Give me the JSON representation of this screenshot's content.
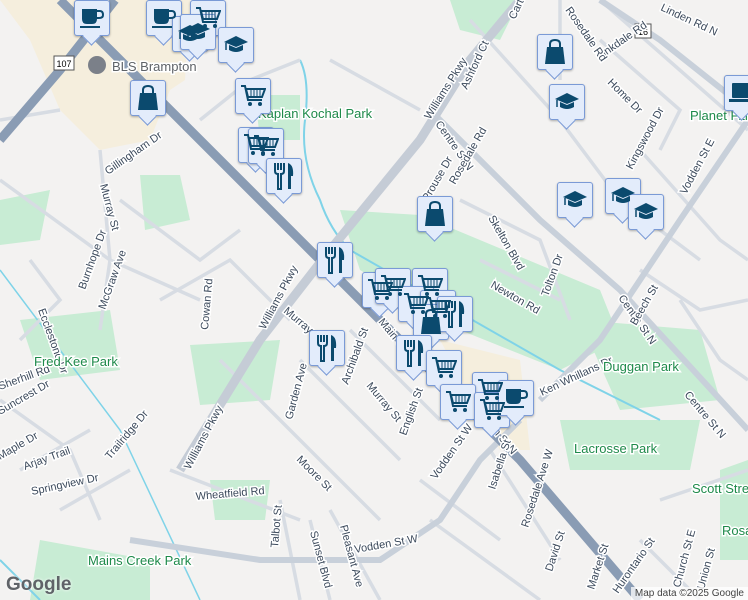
{
  "map": {
    "poi": "BLS Brampton",
    "route_shields": [
      "107",
      "16"
    ],
    "parks": [
      "Kaplan Kochal Park",
      "Fred Kee Park",
      "Duggan Park",
      "Lacrosse Park",
      "Planet Fitness",
      "Scott Street Parkette",
      "Rosalea Park",
      "Mains Creek Park"
    ],
    "streets": [
      "Williams Pkwy",
      "Williams Pkwy",
      "Williams Pkwy",
      "Gillingham Dr",
      "Murray St",
      "Murray St",
      "Murray St",
      "Burnhope Dr",
      "McGraw Ave",
      "Ecclestone Dr",
      "Cowan Rd",
      "Garden Ave",
      "Archibald St",
      "Main St N",
      "Main St N",
      "English St",
      "Centre St N",
      "Centre St N",
      "Centre St N",
      "Prouse Dr",
      "Rosedale Rd",
      "Skelton Blvd",
      "Newton Rd",
      "Tolton Dr",
      "Ashford Ct",
      "Carter Dr",
      "Linkdale Rd",
      "Home Dr",
      "Kingswood Dr",
      "Vodden St E",
      "Beech St",
      "Ken Whillans Dr",
      "Moore St",
      "Wheatfield Rd",
      "Talbot St",
      "Vodden St W",
      "Vodden St W",
      "Isabella St",
      "Rosedale Ave W",
      "David St",
      "Market St",
      "Church St E",
      "Union St",
      "Hurontario St",
      "Sunset Blvd",
      "Pleasant Ave",
      "Suncrest Dr",
      "Maple Dr",
      "Arjay Trail",
      "Trailridge Dr",
      "Springview Dr",
      "Sherhill Rd",
      "Linden Rd N",
      "Rosedale Rd"
    ],
    "markers": [
      "coffee",
      "coffee",
      "cart",
      "school",
      "school",
      "school",
      "bag",
      "cart",
      "cart",
      "cart",
      "restaurant",
      "restaurant",
      "bag",
      "school",
      "laptop",
      "bag",
      "school",
      "school",
      "school",
      "cart",
      "cart",
      "cart",
      "cart",
      "cart",
      "bag",
      "restaurant",
      "restaurant",
      "restaurant",
      "cart",
      "cart",
      "cart",
      "cart",
      "coffee"
    ]
  },
  "footer": {
    "logo": "Google",
    "attribution": "Map data ©2025 Google"
  },
  "colors": {
    "marker_icon": "#0b4a6e",
    "park": "#c8ecd4",
    "major_road": "#8a9cb4",
    "road": "#d7dce3",
    "water": "#7fd3e8"
  }
}
